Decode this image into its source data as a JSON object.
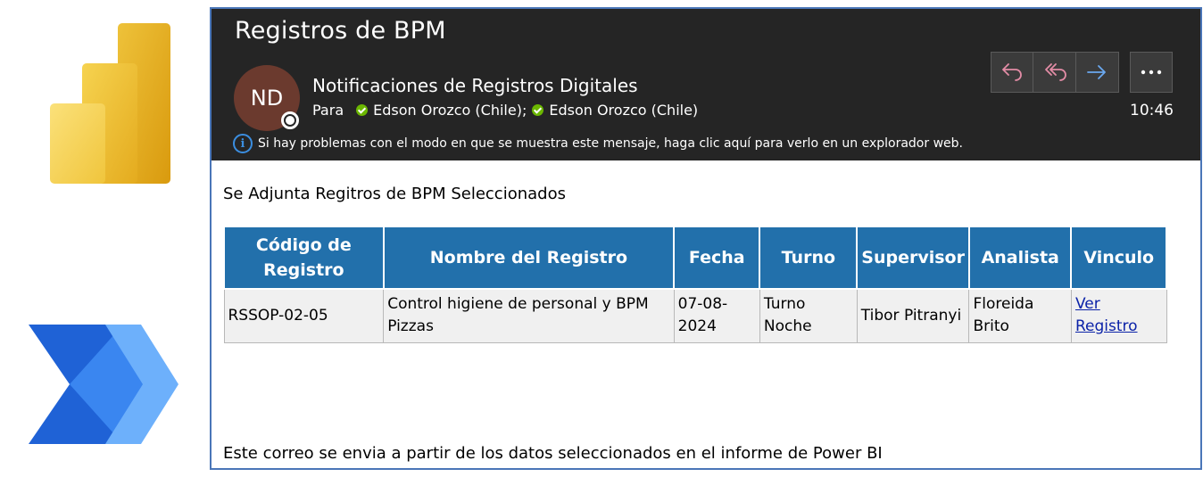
{
  "email": {
    "subject": "Registros de BPM",
    "avatar_initials": "ND",
    "sender": "Notificaciones de Registros Digitales",
    "to_label": "Para",
    "recipients": [
      "Edson Orozco (Chile);",
      "Edson Orozco (Chile)"
    ],
    "time": "10:46",
    "info_message": "Si hay problemas con el modo en que se muestra este mensaje, haga clic aquí para verlo en un explorador web.",
    "actions": [
      "reply-icon",
      "reply-all-icon",
      "forward-icon",
      "more-icon"
    ],
    "accent_color": "#2270ab",
    "presence_ok_color": "#6bb700"
  },
  "body": {
    "intro": "Se Adjunta Regitros de BPM Seleccionados",
    "footer": "Este correo se envia a partir de los datos seleccionados en el informe de Power BI"
  },
  "table": {
    "headers": [
      "Código de Registro",
      "Nombre del Registro",
      "Fecha",
      "Turno",
      "Supervisor",
      "Analista",
      "Vinculo"
    ],
    "rows": [
      {
        "codigo": "RSSOP-02-05",
        "nombre": "Control higiene de personal y BPM Pizzas",
        "fecha": "07-08-2024",
        "turno": "Turno Noche",
        "supervisor": "Tibor Pitranyi",
        "analista": "Floreida Brito",
        "vinculo": "Ver Registro"
      }
    ]
  },
  "logos": [
    "power-bi-logo",
    "power-automate-logo"
  ]
}
